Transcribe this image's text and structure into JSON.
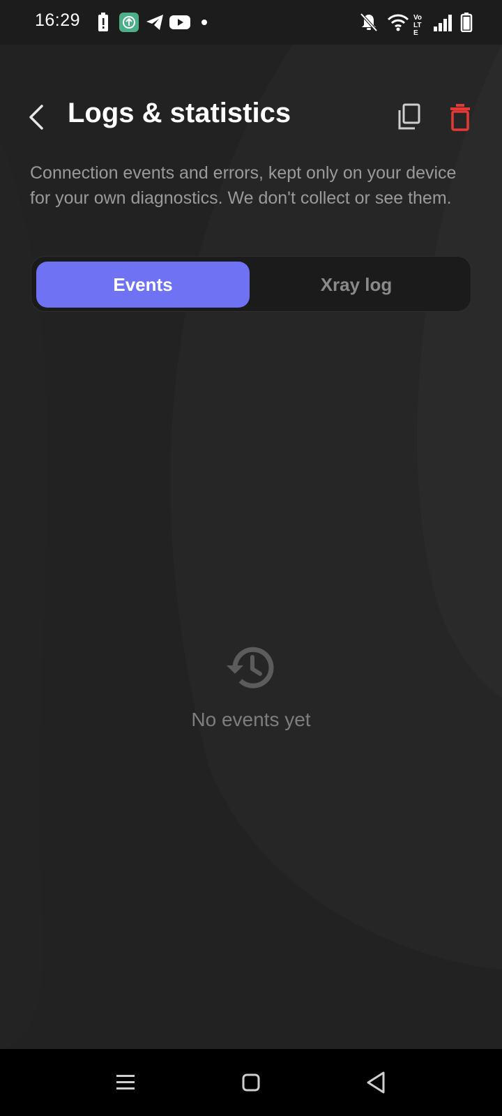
{
  "status_bar": {
    "time": "16:29",
    "left_icons": [
      "battery-alert-icon",
      "app-upload-icon",
      "telegram-icon",
      "youtube-icon",
      "notification-dot-icon"
    ],
    "right_icons": [
      "bell-off-icon",
      "wifi-icon",
      "volte-icon",
      "signal-icon",
      "battery-icon"
    ],
    "volte_label": "Vo LTE"
  },
  "header": {
    "title": "Logs & statistics",
    "back_icon": "chevron-left-icon",
    "copy_icon": "copy-icon",
    "delete_icon": "trash-icon"
  },
  "description": "Connection events and errors, kept only on your device for your own diagnostics. We don't collect or see them.",
  "tabs": [
    {
      "label": "Events",
      "selected": true
    },
    {
      "label": "Xray log",
      "selected": false
    }
  ],
  "empty_state": {
    "icon": "history-icon",
    "text": "No events yet"
  },
  "nav_bar": {
    "icons": [
      "menu-icon",
      "home-icon",
      "back-triangle-icon"
    ]
  },
  "colors": {
    "accent": "#6f72f2",
    "delete": "#e53935",
    "background": "#262626"
  }
}
